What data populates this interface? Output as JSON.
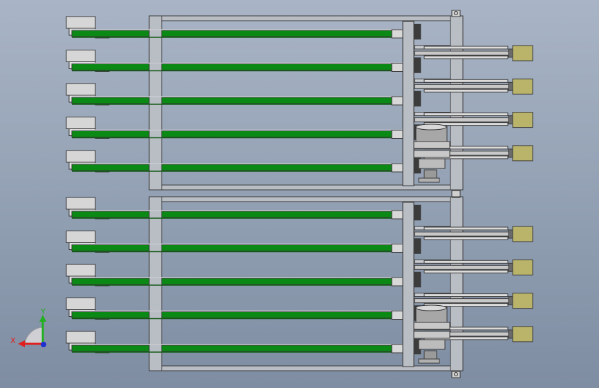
{
  "viewport": {
    "background_top": "#a9b5c6",
    "background_bottom": "#7e8da2"
  },
  "colors": {
    "frame_fill": "#b9bdc4",
    "frame_stroke": "#3a3a3a",
    "belt_green": "#0a8a14",
    "belt_dark": "#145a18",
    "rail_gray": "#c9ccd1",
    "motor_fill": "#d6d6d6",
    "cylinder_fill": "#c8c8c8",
    "end_block": "#b9b46a",
    "axis_x": "#e02020",
    "axis_y": "#20b020",
    "axis_z": "#2030d0"
  },
  "assembly": {
    "modules": [
      {
        "id": "upper",
        "lanes": 5,
        "cylinders": 4
      },
      {
        "id": "lower",
        "lanes": 5,
        "cylinders": 4
      }
    ]
  },
  "triad": {
    "x_label": "X",
    "y_label": "Y",
    "x_icon": "x-axis-arrow-icon",
    "y_icon": "y-axis-arrow-icon",
    "z_icon": "z-axis-dot-icon"
  }
}
